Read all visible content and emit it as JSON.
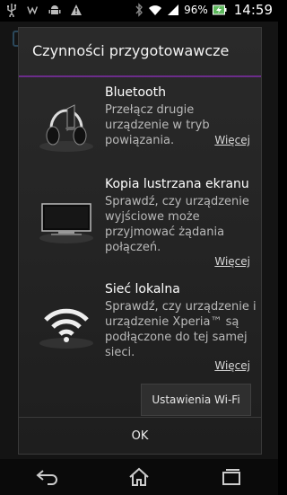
{
  "status_bar": {
    "battery_percent": "96%",
    "time": "14:59"
  },
  "dialog": {
    "title": "Czynności przygotowawcze",
    "sections": [
      {
        "title": "Bluetooth",
        "description": "Przełącz drugie urządzenie w tryb powiązania.",
        "more_label": "Więcej",
        "icon": "headphones-icon"
      },
      {
        "title": "Kopia lustrzana ekranu",
        "description": "Sprawdź, czy urządzenie wyjściowe może przyjmować żądania połączeń.",
        "more_label": "Więcej",
        "icon": "tv-icon"
      },
      {
        "title": "Sieć lokalna",
        "description": "Sprawdź, czy urządzenie i urządzenie Xperia™ są podłączone do tej samej sieci.",
        "more_label": "Więcej",
        "icon": "wifi-icon"
      }
    ],
    "wifi_settings_label": "Ustawienia Wi-Fi",
    "ok_label": "OK"
  },
  "navigation": {
    "back": "back-icon",
    "home": "home-icon",
    "recents": "recents-icon"
  }
}
